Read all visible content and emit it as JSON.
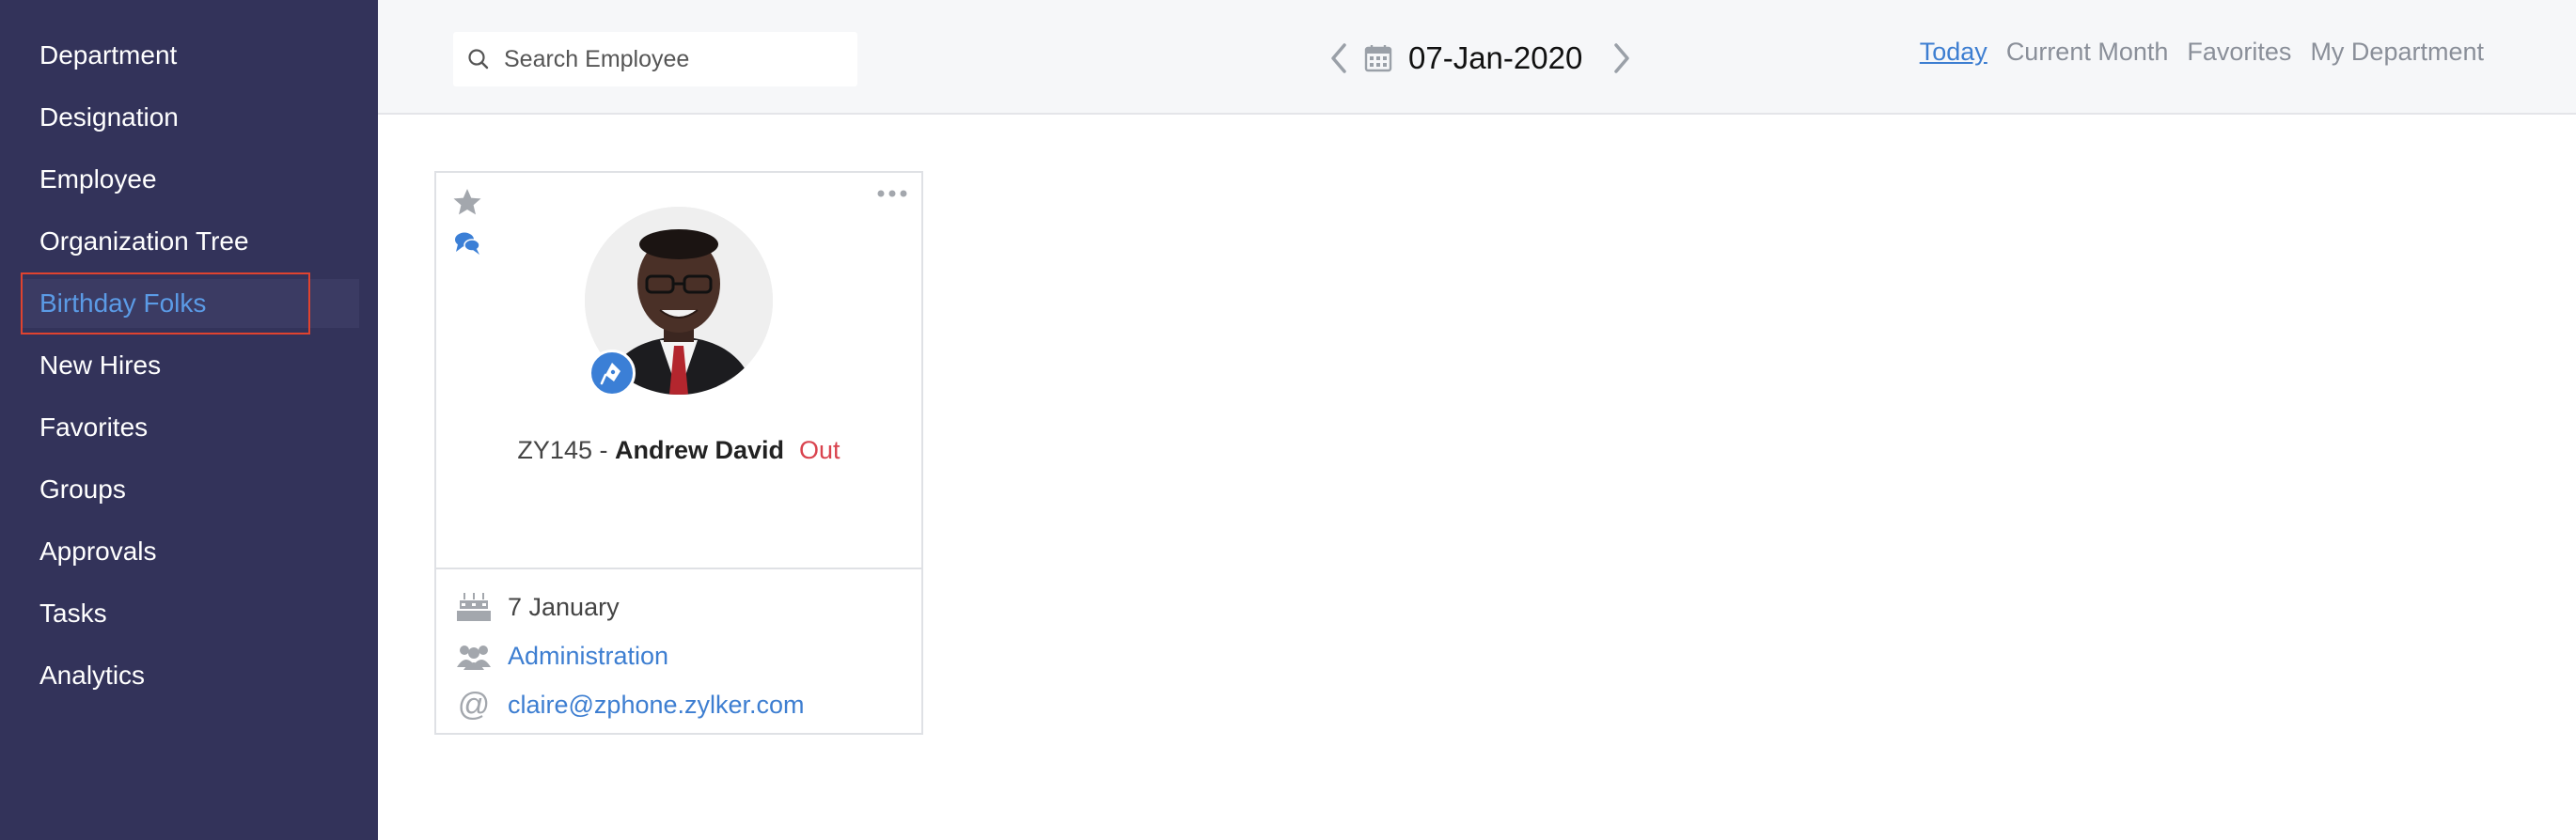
{
  "sidebar": {
    "items": [
      {
        "label": "Department"
      },
      {
        "label": "Designation"
      },
      {
        "label": "Employee"
      },
      {
        "label": "Organization Tree"
      },
      {
        "label": "Birthday Folks"
      },
      {
        "label": "New Hires"
      },
      {
        "label": "Favorites"
      },
      {
        "label": "Groups"
      },
      {
        "label": "Approvals"
      },
      {
        "label": "Tasks"
      },
      {
        "label": "Analytics"
      }
    ],
    "active": "Birthday Folks"
  },
  "topbar": {
    "search": {
      "placeholder": "Search Employee",
      "value": ""
    },
    "date": "07-Jan-2020",
    "filters": [
      {
        "label": "Today",
        "active": true
      },
      {
        "label": "Current Month",
        "active": false
      },
      {
        "label": "Favorites",
        "active": false
      },
      {
        "label": "My Department",
        "active": false
      }
    ]
  },
  "card": {
    "employee_id": "ZY145",
    "separator": " - ",
    "name": "Andrew David",
    "status": "Out",
    "birthday": "7 January",
    "department": "Administration",
    "email": "claire@zphone.zylker.com"
  },
  "colors": {
    "sidebar_bg": "#33335a",
    "active_text": "#5b9be6",
    "highlight_border": "#e0432f",
    "link": "#3d7ed1",
    "status_out": "#d9434e"
  },
  "icons": [
    "search-icon",
    "chevron-left-icon",
    "calendar-icon",
    "chevron-right-icon",
    "star-icon",
    "chat-icon",
    "more-icon",
    "pen-badge-icon",
    "cake-icon",
    "group-icon",
    "at-icon"
  ]
}
